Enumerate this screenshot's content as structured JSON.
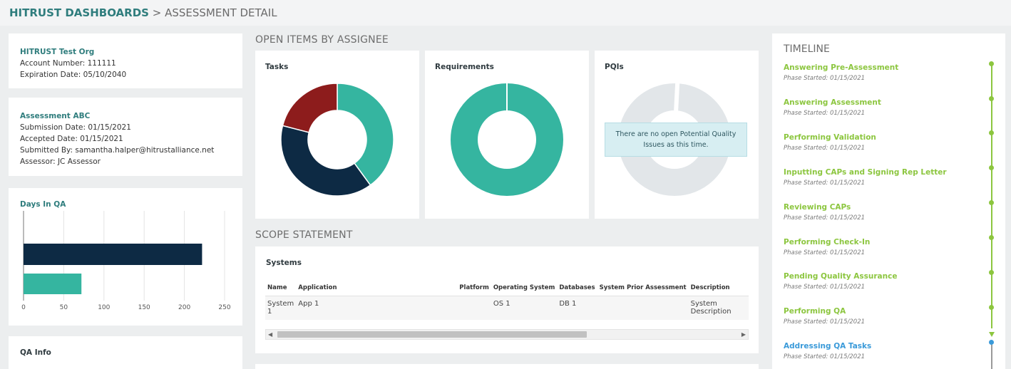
{
  "breadcrumb": {
    "root": "HITRUST DASHBOARDS",
    "separator": ">",
    "current": "ASSESSMENT DETAIL"
  },
  "org": {
    "name": "HITRUST Test Org",
    "account_number": "Account Number: 111111",
    "expiration": "Expiration Date: 05/10/2040"
  },
  "assessment": {
    "name": "Assessment ABC",
    "submission_date": "Submission Date: 01/15/2021",
    "accepted_date": "Accepted Date: 01/15/2021",
    "submitted_by": "Submitted By: samantha.halper@hitrustalliance.net",
    "assessor": "Assessor: JC Assessor"
  },
  "days_in_qa": {
    "title": "Days In QA",
    "chart_data": {
      "type": "bar",
      "orientation": "horizontal",
      "series": [
        {
          "values": [
            222
          ],
          "color": "#0d2a44"
        },
        {
          "values": [
            72
          ],
          "color": "#35b5a0"
        }
      ],
      "xlim": [
        0,
        250
      ],
      "xticks": [
        "0",
        "50",
        "100",
        "150",
        "200",
        "250"
      ],
      "grid": true
    }
  },
  "qa_info": {
    "title": "QA Info"
  },
  "open_items": {
    "section_title": "OPEN ITEMS BY ASSIGNEE",
    "tasks": {
      "title": "Tasks",
      "chart_data": {
        "type": "pie",
        "donut": true,
        "values": [
          40,
          39,
          21
        ],
        "colors": [
          "#35b5a0",
          "#0d2a44",
          "#8d1c1c"
        ]
      }
    },
    "requirements": {
      "title": "Requirements",
      "chart_data": {
        "type": "pie",
        "donut": true,
        "values": [
          100
        ],
        "colors": [
          "#35b5a0"
        ]
      }
    },
    "pqis": {
      "title": "PQIs",
      "message": "There are no open Potential Quality Issues as this time.",
      "placeholder_color": "#e2e6e9"
    }
  },
  "scope": {
    "section_title": "SCOPE STATEMENT",
    "systems_title": "Systems",
    "columns": [
      "Name",
      "Application",
      "Platform",
      "Operating System",
      "Databases",
      "System Prior Assessment",
      "Description"
    ],
    "rows": [
      [
        "System 1",
        "App 1",
        "",
        "OS 1",
        "DB 1",
        "",
        "System Description"
      ]
    ],
    "scroll_left": "◀",
    "scroll_right": "▶"
  },
  "timeline": {
    "title": "TIMELINE",
    "items": [
      {
        "phase": "Answering Pre-Assessment",
        "date": "Phase Started: 01/15/2021",
        "state": "done"
      },
      {
        "phase": "Answering Assessment",
        "date": "Phase Started: 01/15/2021",
        "state": "done"
      },
      {
        "phase": "Performing Validation",
        "date": "Phase Started: 01/15/2021",
        "state": "done"
      },
      {
        "phase": "Inputting CAPs and Signing Rep Letter",
        "date": "Phase Started: 01/15/2021",
        "state": "done"
      },
      {
        "phase": "Reviewing CAPs",
        "date": "Phase Started: 01/15/2021",
        "state": "done"
      },
      {
        "phase": "Performing Check-In",
        "date": "Phase Started: 01/15/2021",
        "state": "done"
      },
      {
        "phase": "Pending Quality Assurance",
        "date": "Phase Started: 01/15/2021",
        "state": "done"
      },
      {
        "phase": "Performing QA",
        "date": "Phase Started: 01/15/2021",
        "state": "done"
      },
      {
        "phase": "Addressing QA Tasks",
        "date": "Phase Started: 01/15/2021",
        "state": "active"
      }
    ],
    "done_color": "#8cc63f",
    "active_color": "#3a9ad9"
  }
}
